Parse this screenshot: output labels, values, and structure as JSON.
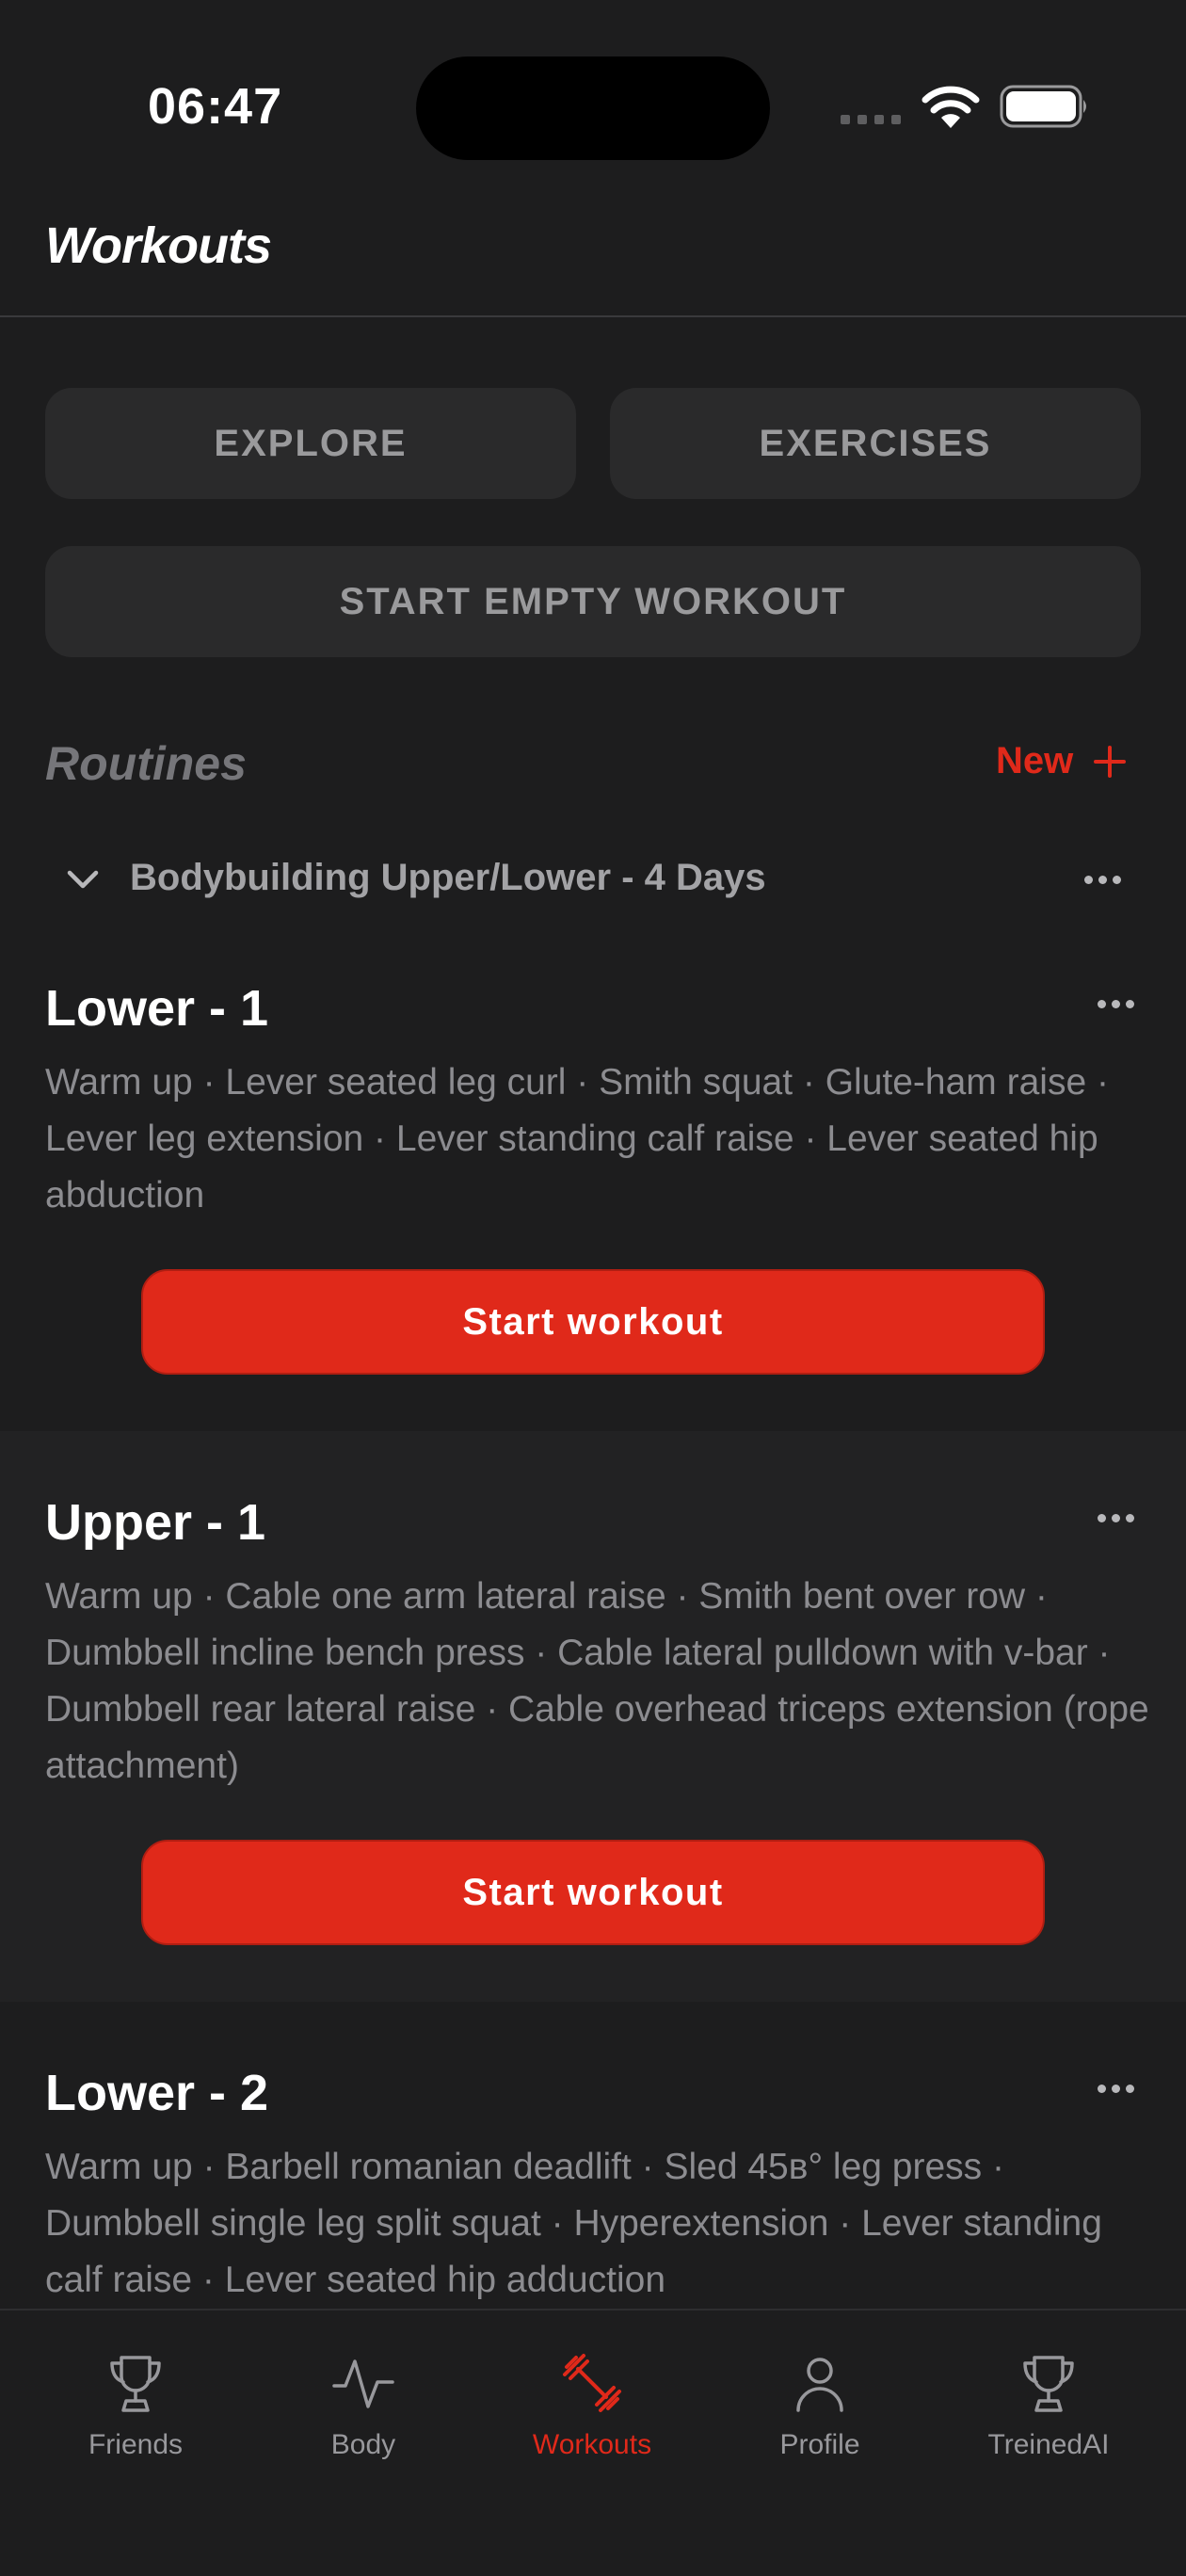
{
  "status_bar": {
    "time": "06:47"
  },
  "header": {
    "title": "Workouts"
  },
  "actions": {
    "explore": "EXPLORE",
    "exercises": "EXERCISES",
    "start_empty": "START EMPTY WORKOUT"
  },
  "routines": {
    "label": "Routines",
    "new_label": "New",
    "folder_name": "Bodybuilding Upper/Lower - 4 Days",
    "items": [
      {
        "title": "Lower - 1",
        "description": "Warm up · Lever seated leg curl · Smith squat · Glute-ham raise · Lever leg extension · Lever standing calf raise · Lever seated hip abduction",
        "button": "Start workout"
      },
      {
        "title": "Upper - 1",
        "description": "Warm up · Cable one arm lateral raise · Smith bent over row · Dumbbell incline bench press · Cable lateral pulldown with v-bar · Dumbbell rear lateral raise · Cable overhead triceps extension (rope attachment)",
        "button": "Start workout"
      },
      {
        "title": "Lower - 2",
        "description": "Warm up · Barbell romanian deadlift · Sled 45в° leg press · Dumbbell single leg split squat · Hyperextension · Lever standing calf raise · Lever seated hip adduction"
      }
    ]
  },
  "tabbar": {
    "tabs": [
      {
        "label": "Friends",
        "icon": "trophy-icon"
      },
      {
        "label": "Body",
        "icon": "pulse-icon"
      },
      {
        "label": "Workouts",
        "icon": "dumbbell-icon",
        "active": true
      },
      {
        "label": "Profile",
        "icon": "person-icon"
      },
      {
        "label": "TreinedAI",
        "icon": "trophy-icon"
      }
    ]
  },
  "colors": {
    "accent": "#e0291a",
    "background": "#1d1d1e",
    "card_alt": "#222223",
    "button_gray": "#2a2a2b"
  }
}
